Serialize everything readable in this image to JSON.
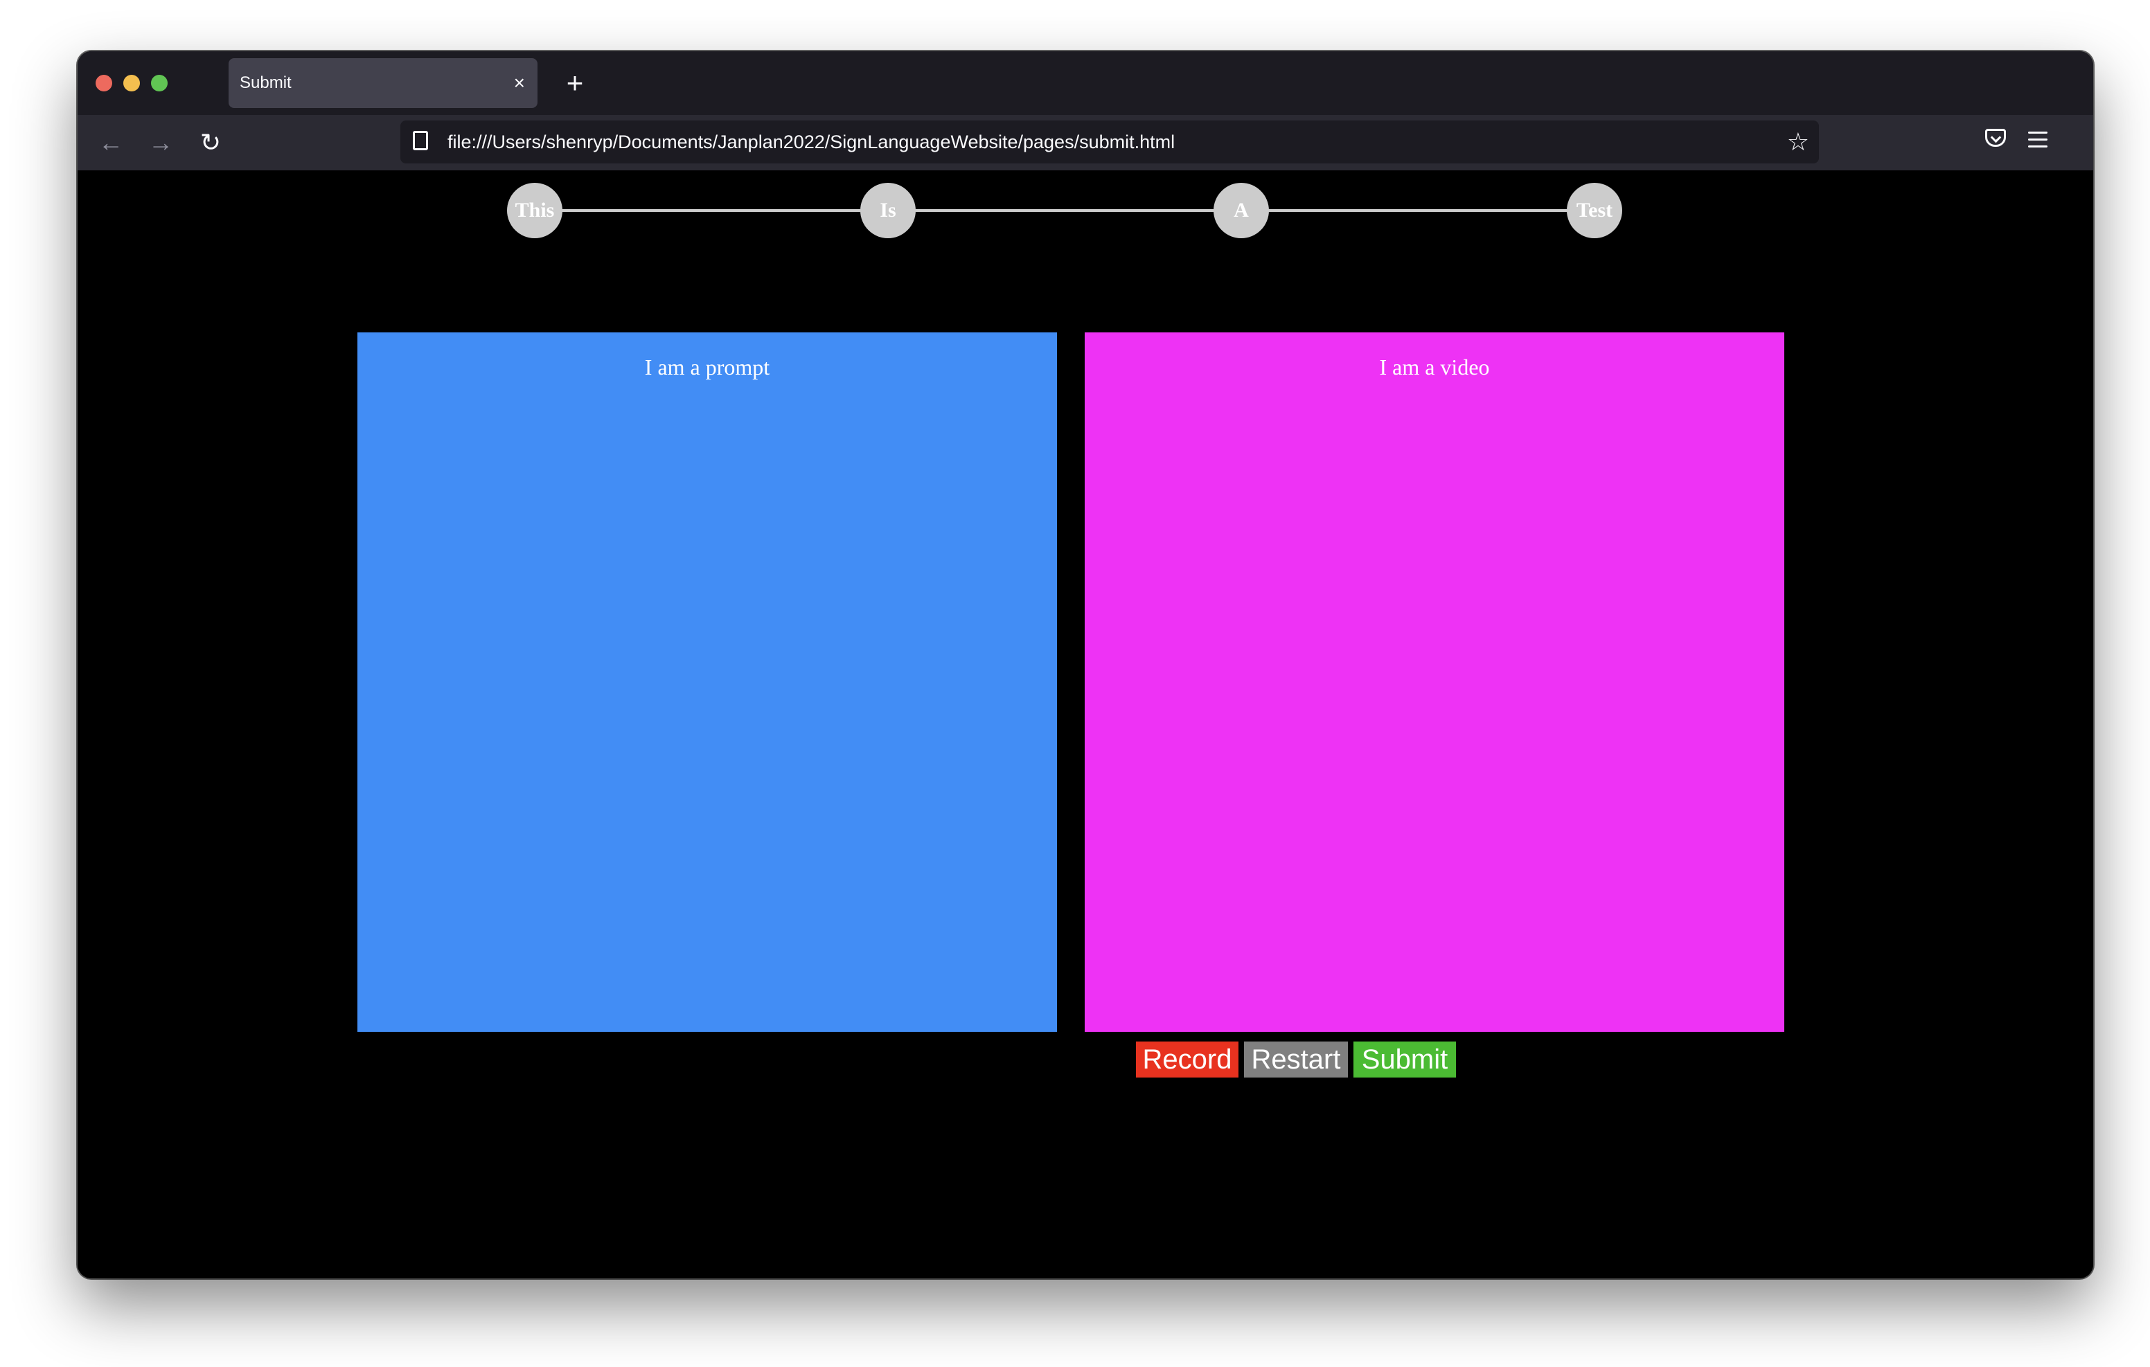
{
  "browser": {
    "tab_title": "Submit",
    "tab_close": "×",
    "new_tab": "+",
    "url": "file:///Users/shenryp/Documents/Janplan2022/SignLanguageWebsite/pages/submit.html",
    "back_icon": "←",
    "forward_icon": "→",
    "reload_icon": "↻",
    "star_icon": "☆"
  },
  "progress": {
    "steps": [
      "This",
      "Is",
      "A",
      "Test"
    ]
  },
  "panels": {
    "prompt_label": "I am a prompt",
    "video_label": "I am a video",
    "prompt_color": "#428df5",
    "video_color": "#ee32f5"
  },
  "buttons": {
    "record": "Record",
    "restart": "Restart",
    "submit": "Submit",
    "record_color": "#e8321f",
    "restart_color": "#808080",
    "submit_color": "#4bbb33"
  }
}
